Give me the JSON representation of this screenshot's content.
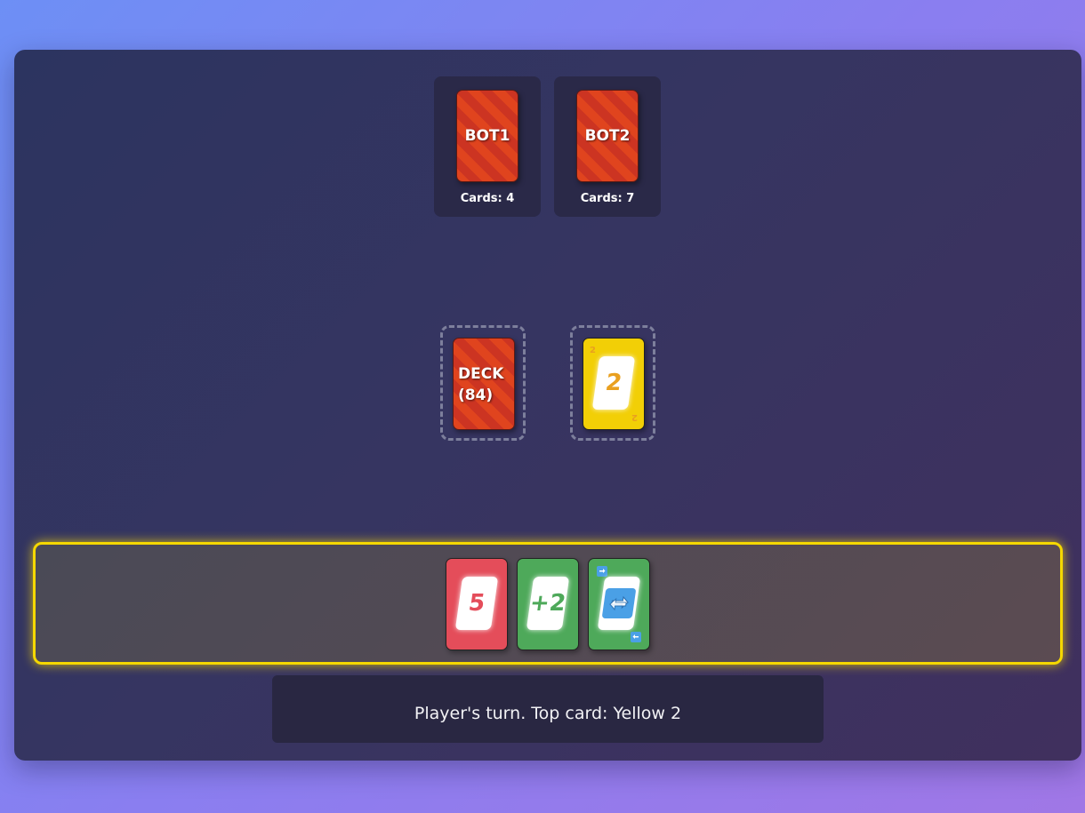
{
  "bots": [
    {
      "name": "BOT1",
      "cards_label": "Cards: 4",
      "card_count": 4
    },
    {
      "name": "BOT2",
      "cards_label": "Cards: 7",
      "card_count": 7
    }
  ],
  "deck": {
    "label_line1": "DECK",
    "label_line2": "(84)",
    "count": 84
  },
  "discard": {
    "color": "Yellow",
    "value": "2",
    "color_hex": "#f2cf06",
    "text_hex": "#e9a020"
  },
  "hand": [
    {
      "color": "Red",
      "value": "5",
      "color_hex": "#e44d5a",
      "text_hex": "#e44d5a"
    },
    {
      "color": "Green",
      "value": "+2",
      "color_hex": "#4ea95a",
      "text_hex": "#4ea95a"
    },
    {
      "color": "Green",
      "value": "reverse",
      "icon": "reverse-arrows-icon",
      "color_hex": "#4ea95a"
    }
  ],
  "status": {
    "message": "Player's turn. Top card: Yellow 2"
  },
  "colors": {
    "highlight": "#f5d800",
    "card_back": "#e0441e",
    "table": "#363561"
  }
}
